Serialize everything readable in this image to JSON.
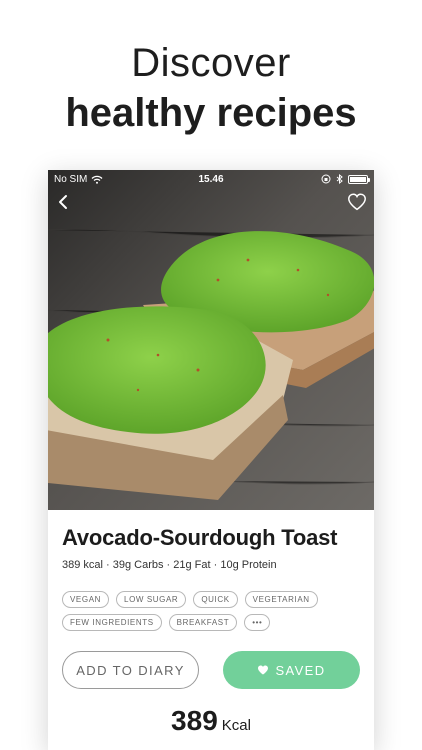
{
  "headline": {
    "line1": "Discover",
    "line2": "healthy recipes"
  },
  "status_bar": {
    "carrier": "No SIM",
    "time": "15.46"
  },
  "recipe": {
    "title": "Avocado-Sourdough Toast",
    "macros": "389 kcal · 39g Carbs · 21g Fat · 10g Protein",
    "tags": [
      "VEGAN",
      "LOW SUGAR",
      "QUICK",
      "VEGETARIAN",
      "FEW INGREDIENTS",
      "BREAKFAST",
      "•••"
    ]
  },
  "actions": {
    "add_to_diary": "ADD TO DIARY",
    "saved": "SAVED"
  },
  "energy": {
    "value": "389",
    "unit": "Kcal"
  },
  "colors": {
    "saved_button": "#72d09a",
    "avocado": "#7cc23c",
    "bread_crust": "#a98b6a"
  },
  "icons": {
    "back": "chevron-left-icon",
    "favorite": "heart-outline-icon",
    "saved": "heart-filled-icon"
  }
}
